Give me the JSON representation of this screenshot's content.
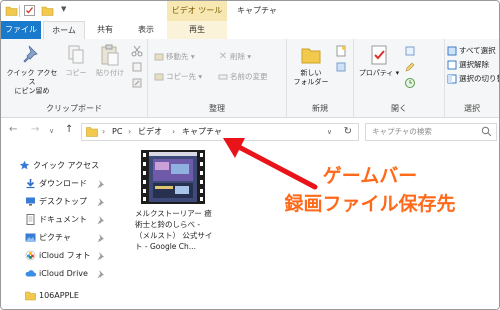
{
  "window": {
    "title": "キャプチャ",
    "context_tab": "ビデオ ツール"
  },
  "tabs": {
    "file": "ファイル",
    "home": "ホーム",
    "share": "共有",
    "view": "表示",
    "play": "再生"
  },
  "ribbon": {
    "clipboard": {
      "label": "クリップボード",
      "pin": "クイック アクセス\nにピン留め",
      "copy": "コピー",
      "paste": "貼り付け"
    },
    "organize": {
      "label": "整理",
      "move_to": "移動先",
      "copy_to": "コピー先",
      "delete": "削除",
      "rename": "名前の変更"
    },
    "new": {
      "label": "新規",
      "new_folder": "新しい\nフォルダー"
    },
    "open": {
      "label": "開く",
      "properties": "プロパティ"
    },
    "select": {
      "label": "選択",
      "select_all": "すべて選択",
      "select_none": "選択解除",
      "invert": "選択の切り替"
    }
  },
  "address": {
    "crumbs": [
      "PC",
      "ビデオ",
      "キャプチャ"
    ],
    "search_placeholder": "キャプチャの検索"
  },
  "sidebar": {
    "items": [
      {
        "label": "クイック アクセス",
        "icon": "star-icon"
      },
      {
        "label": "ダウンロード",
        "icon": "download-icon"
      },
      {
        "label": "デスクトップ",
        "icon": "desktop-icon"
      },
      {
        "label": "ドキュメント",
        "icon": "document-icon"
      },
      {
        "label": "ピクチャ",
        "icon": "picture-icon"
      },
      {
        "label": "iCloud フォト",
        "icon": "icloud-photos-icon"
      },
      {
        "label": "iCloud Drive",
        "icon": "icloud-drive-icon"
      },
      {
        "label": "106APPLE",
        "icon": "folder-icon"
      }
    ]
  },
  "files": [
    {
      "name": "メルクストーリアー 癒術士と鈴のしらべ - （メルスト） 公式サイト - Google Ch..."
    }
  ],
  "annotation": {
    "line1": "ゲームバー",
    "line2": "録画ファイル保存先"
  },
  "colors": {
    "accent": "#1979ca",
    "callout": "#ff6a1a",
    "arrow": "#e8141a",
    "context_tab": "#f6e7b3"
  }
}
